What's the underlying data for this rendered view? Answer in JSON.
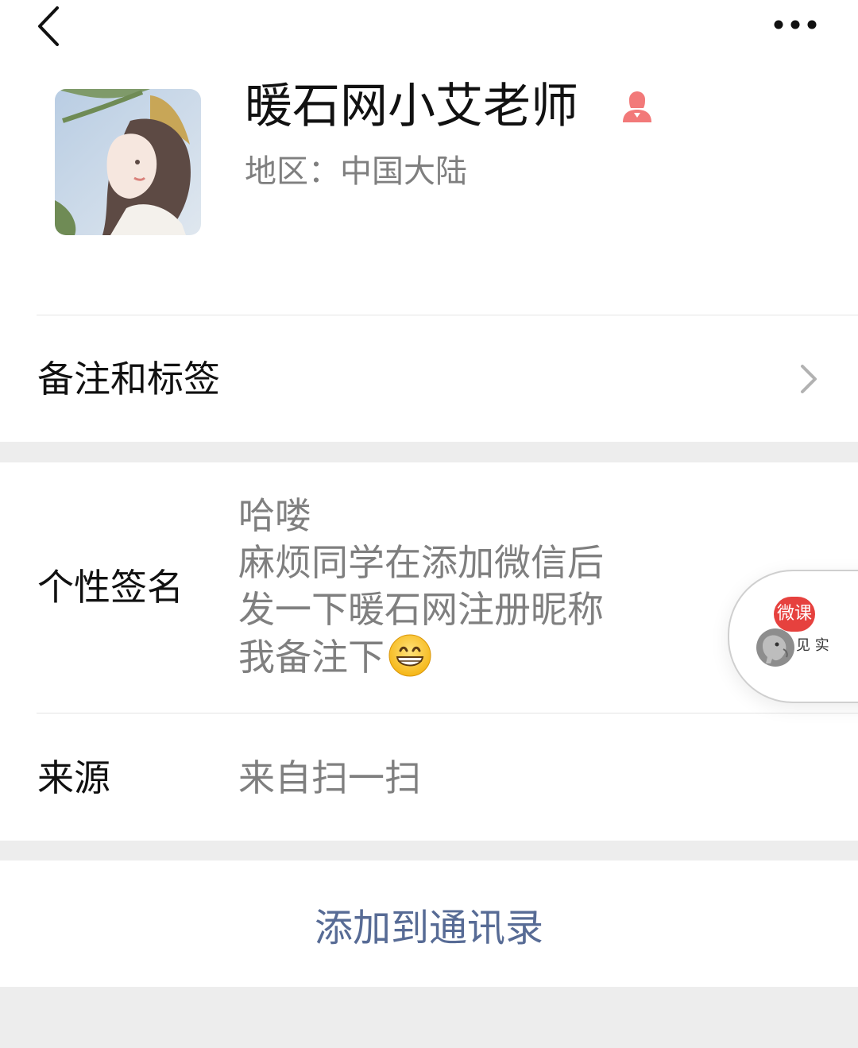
{
  "header": {
    "back_icon": "chevron-left-icon",
    "more_icon": "more-dots-icon"
  },
  "profile": {
    "name": "暖石网小艾老师",
    "region": "地区：中国大陆",
    "gender_icon": "female-person-icon",
    "gender_color": "#fa5151"
  },
  "rows": {
    "remark_label": "备注和标签",
    "signature_label": "个性签名",
    "signature_lines": [
      "哈喽",
      "麻烦同学在添加微信后",
      "发一下暖石网注册昵称",
      "我备注下"
    ],
    "signature_emoji": "grinning-face-emoji",
    "source_label": "来源",
    "source_value": "来自扫一扫"
  },
  "floating_widget": {
    "badge_text": "微课",
    "brand_text": "见 实",
    "badge_color": "#e6413e"
  },
  "actions": {
    "add_contact_label": "添加到通讯录",
    "link_color": "#576b95"
  }
}
